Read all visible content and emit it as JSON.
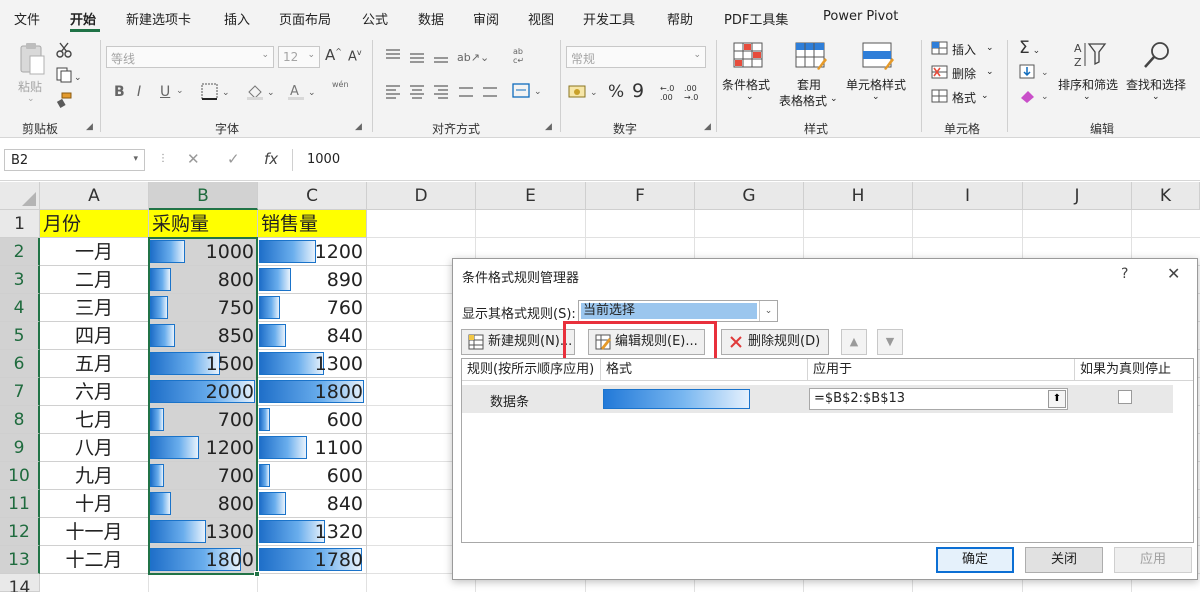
{
  "colors": {
    "accent_green": "#217346",
    "header_yellow": "#ffff00",
    "databar_blue": "#1a73c9",
    "highlight_red": "#e8303c",
    "select_blue": "#9bc6ee"
  },
  "ribbon_tabs": [
    "文件",
    "开始",
    "新建选项卡",
    "插入",
    "页面布局",
    "公式",
    "数据",
    "审阅",
    "视图",
    "开发工具",
    "帮助",
    "PDF工具集",
    "Power Pivot"
  ],
  "active_tab": "开始",
  "ribbon": {
    "clipboard": {
      "paste": "粘贴",
      "label": "剪贴板",
      "icons": [
        "paste-icon",
        "cut-icon",
        "copy-icon",
        "format-painter-icon"
      ]
    },
    "font": {
      "font_name": "等线",
      "font_size": "12",
      "bold": "B",
      "italic": "I",
      "underline": "U",
      "grow": "A",
      "shrink": "A",
      "phonetic": "wén",
      "label": "字体"
    },
    "alignment": {
      "label": "对齐方式"
    },
    "number": {
      "format": "常规",
      "percent": "%",
      "comma": "9",
      "label": "数字"
    },
    "styles": {
      "conditional": "条件格式",
      "table1": "套用",
      "table2": "表格格式",
      "cell_style": "单元格样式",
      "label": "样式"
    },
    "cells": {
      "insert": "插入",
      "delete": "删除",
      "format": "格式",
      "label": "单元格"
    },
    "editing": {
      "sort_filter": "排序和筛选",
      "find_select": "查找和选择",
      "label": "编辑"
    }
  },
  "formula_bar": {
    "name_box": "B2",
    "cancel": "✕",
    "enter": "✓",
    "fx": "fx",
    "formula": "1000"
  },
  "sheet": {
    "columns": [
      "A",
      "B",
      "C",
      "D",
      "E",
      "F",
      "G",
      "H",
      "I",
      "J",
      "K"
    ],
    "rows": [
      "1",
      "2",
      "3",
      "4",
      "5",
      "6",
      "7",
      "8",
      "9",
      "10",
      "11",
      "12",
      "13",
      "14"
    ],
    "header": {
      "month": "月份",
      "purchase": "采购量",
      "sales": "销售量"
    },
    "data": [
      {
        "month": "一月",
        "purchase": "1000",
        "sales": "1200",
        "p": 1000,
        "s": 1200
      },
      {
        "month": "二月",
        "purchase": "800",
        "sales": "890",
        "p": 800,
        "s": 890
      },
      {
        "month": "三月",
        "purchase": "750",
        "sales": "760",
        "p": 750,
        "s": 760
      },
      {
        "month": "四月",
        "purchase": "850",
        "sales": "840",
        "p": 850,
        "s": 840
      },
      {
        "month": "五月",
        "purchase": "1500",
        "sales": "1300",
        "p": 1500,
        "s": 1300
      },
      {
        "month": "六月",
        "purchase": "2000",
        "sales": "1800",
        "p": 2000,
        "s": 1800
      },
      {
        "month": "七月",
        "purchase": "700",
        "sales": "600",
        "p": 700,
        "s": 600
      },
      {
        "month": "八月",
        "purchase": "1200",
        "sales": "1100",
        "p": 1200,
        "s": 1100
      },
      {
        "month": "九月",
        "purchase": "700",
        "sales": "600",
        "p": 700,
        "s": 600
      },
      {
        "month": "十月",
        "purchase": "800",
        "sales": "840",
        "p": 800,
        "s": 840
      },
      {
        "month": "十一月",
        "purchase": "1300",
        "sales": "1320",
        "p": 1300,
        "s": 1320
      },
      {
        "month": "十二月",
        "purchase": "1800",
        "sales": "1780",
        "p": 1800,
        "s": 1780
      }
    ],
    "databar_min": 500,
    "databar_max_purchase": 2000,
    "databar_max_sales": 1800
  },
  "dialog": {
    "title": "条件格式规则管理器",
    "help": "?",
    "close": "✕",
    "show_rules_label": "显示其格式规则(S):",
    "show_rules_value": "当前选择",
    "new_rule": "新建规则(N)...",
    "edit_rule": "编辑规则(E)...",
    "delete_rule": "删除规则(D)",
    "col_rule": "规则(按所示顺序应用)",
    "col_format": "格式",
    "col_applies": "应用于",
    "col_stop": "如果为真则停止",
    "rule_name": "数据条",
    "rule_applies_to": "=$B$2:$B$13",
    "ok": "确定",
    "cancel": "关闭",
    "apply": "应用"
  }
}
